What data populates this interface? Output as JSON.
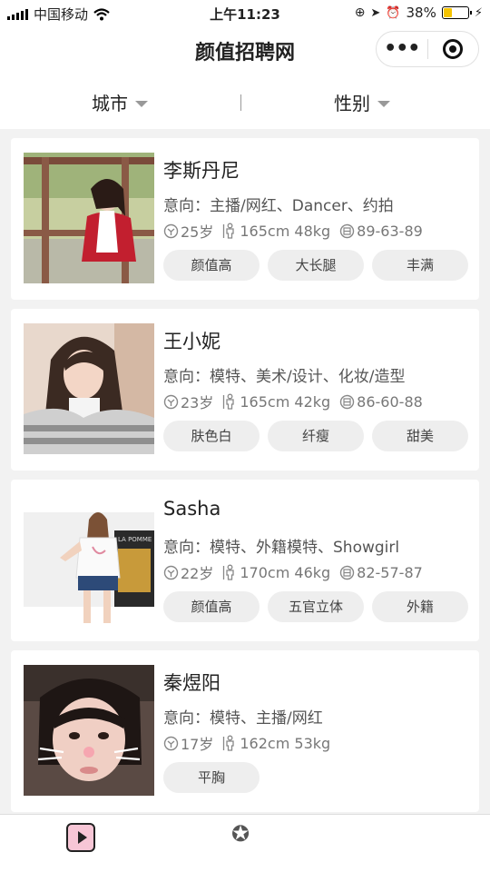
{
  "status_bar": {
    "carrier": "中国移动",
    "time": "上午11:23",
    "battery_text": "38%",
    "battery_level": 0.38
  },
  "nav": {
    "title": "颜值招聘网",
    "more_icon": "ellipsis-icon",
    "close_icon": "target-close-icon"
  },
  "filters": {
    "city_label": "城市",
    "gender_label": "性别"
  },
  "profiles": [
    {
      "name": "李斯丹尼",
      "intent": "意向：主播/网红、Dancer、约拍",
      "age": "25岁",
      "body": "165cm 48kg",
      "measure": "89-63-89",
      "tags": [
        "颜值高",
        "大长腿",
        "丰满"
      ]
    },
    {
      "name": "王小妮",
      "intent": "意向：模特、美术/设计、化妆/造型",
      "age": "23岁",
      "body": "165cm 42kg",
      "measure": "86-60-88",
      "tags": [
        "肤色白",
        "纤瘦",
        "甜美"
      ]
    },
    {
      "name": "Sasha",
      "intent": "意向：模特、外籍模特、Showgirl",
      "age": "22岁",
      "body": "170cm 46kg",
      "measure": "82-57-87",
      "tags": [
        "颜值高",
        "五官立体",
        "外籍"
      ]
    },
    {
      "name": "秦煜阳",
      "intent": "意向：模特、主播/网红",
      "age": "17岁",
      "body": "162cm 53kg",
      "measure": "",
      "tags": [
        "平胸"
      ]
    }
  ],
  "tabbar": {
    "tab1_icon": "play-icon",
    "tab2_icon": "star-badge-icon"
  },
  "colors": {
    "battery": "#f5c400",
    "tag_bg": "#eeeeee",
    "page_bg": "#f2f2f2"
  }
}
